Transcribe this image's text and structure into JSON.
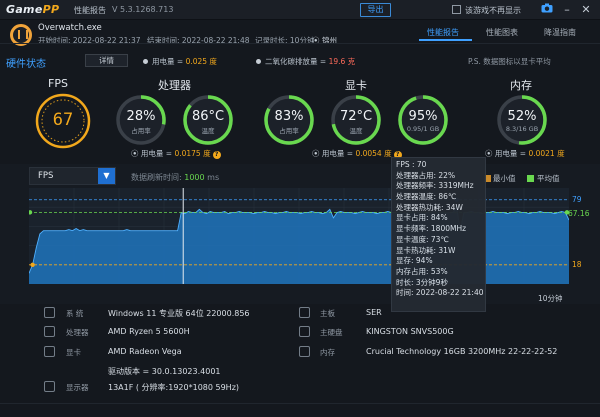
{
  "app": {
    "logo_main": "Game",
    "logo_accent": "PP",
    "menu_label": "性能报告",
    "version": "V 5.3.1268.713",
    "export_label": "导出",
    "no_show_label": "该游戏不再显示"
  },
  "colors": {
    "accent": "#3fa0ff",
    "fps_ring": "#f2a81c",
    "good": "#69d84f",
    "warn": "#f2a81c",
    "danger": "#ff6b5b"
  },
  "icons": [
    "camera-icon",
    "minimize-icon",
    "close-icon",
    "overwatch-logo",
    "location-icon",
    "help-icon"
  ],
  "session": {
    "game": "Overwatch.exe",
    "start": "开始时间: 2022-08-22 21:37",
    "end": "结束时间: 2022-08-22 21:48",
    "duration": "记录时长: 10分钟",
    "location": "锦州"
  },
  "tabs": [
    {
      "label": "性能报告",
      "active": true
    },
    {
      "label": "性能图表",
      "active": false
    },
    {
      "label": "降温指南",
      "active": false
    }
  ],
  "hardware_status": {
    "title": "硬件状态",
    "detail_btn": "详情",
    "power_label": "用电量 = ",
    "power_value": "0.025 度",
    "co2_label": "二氧化碳排放量 = ",
    "co2_value": "19.6 克",
    "ps_note": "P.S. 数据图标以显卡平均"
  },
  "gauges": {
    "fps": {
      "title": "FPS",
      "value": "67"
    },
    "cpu": {
      "title": "处理器",
      "items": [
        {
          "value": "28%",
          "label": "占用率",
          "fill": 0.28,
          "color": "#69d84f"
        },
        {
          "value": "86°C",
          "label": "温度",
          "fill": 0.86,
          "color": "#69d84f"
        }
      ],
      "power_label": "用电量 = ",
      "power_value": "0.0175 度"
    },
    "gpu": {
      "title": "显卡",
      "items": [
        {
          "value": "83%",
          "label": "占用率",
          "fill": 0.83,
          "color": "#69d84f"
        },
        {
          "value": "72°C",
          "label": "温度",
          "fill": 0.72,
          "color": "#69d84f"
        },
        {
          "value": "95%",
          "label": "0.95/1 GB",
          "fill": 0.95,
          "color": "#69d84f"
        }
      ],
      "power_label": "用电量 = ",
      "power_value": "0.0054 度"
    },
    "mem": {
      "title": "内存",
      "items": [
        {
          "value": "52%",
          "label": "8.3/16 GB",
          "fill": 0.52,
          "color": "#69d84f"
        }
      ],
      "power_label": "用电量 = ",
      "power_value": "0.0021 度"
    }
  },
  "chart_controls": {
    "metric": "FPS",
    "refresh_label": "数据刷新时间: ",
    "refresh_value": "1000",
    "refresh_unit": " ms",
    "legend_min": "最小值",
    "legend_avg": "平均值"
  },
  "chart_data": {
    "type": "area",
    "series": [
      {
        "name": "FPS",
        "values": [
          10,
          18,
          34,
          47,
          50,
          50,
          50,
          50,
          50,
          50,
          50,
          51,
          50,
          52,
          50,
          51,
          50,
          50,
          50,
          50,
          50,
          50,
          50,
          50,
          50,
          50,
          50,
          51,
          50,
          50,
          50,
          50,
          50,
          50,
          50,
          50,
          50,
          50,
          50,
          50,
          50,
          50,
          67,
          66,
          68,
          67,
          67,
          70,
          67,
          66,
          68,
          67,
          67,
          67,
          68,
          66,
          67,
          67,
          68,
          67,
          67,
          67,
          66,
          67,
          67,
          68,
          67,
          67,
          66,
          67,
          67,
          68,
          67,
          67,
          67,
          66,
          67,
          67,
          68,
          67,
          67,
          66,
          67,
          70,
          62,
          67,
          68,
          67,
          67,
          67,
          66,
          67,
          68,
          67,
          67,
          67,
          66,
          67,
          67,
          68,
          67,
          67,
          67,
          66,
          67,
          67,
          68,
          67,
          67,
          66,
          67,
          67,
          68,
          67,
          67,
          66,
          67,
          67,
          72,
          50,
          67,
          67,
          68,
          67,
          67,
          66,
          67,
          67,
          68,
          67,
          67,
          67,
          66,
          67,
          67,
          68,
          67,
          67,
          66,
          67,
          67,
          68,
          67,
          67,
          67,
          66,
          67,
          68,
          67,
          60
        ]
      }
    ],
    "max": 79,
    "min": 18,
    "avg": 67.16,
    "y_labels": {
      "max": "79",
      "min": "18",
      "avg": "67.16"
    },
    "x_end_label": "10分钟",
    "ylim": [
      0,
      90
    ],
    "grid": true
  },
  "tooltip": [
    "FPS : 70",
    "处理器占用: 22%",
    "处理器频率: 3319MHz",
    "处理器温度: 86℃",
    "处理器热功耗: 34W",
    "显卡占用: 84%",
    "显卡频率: 1800MHz",
    "显卡温度: 73℃",
    "显卡热功耗: 31W",
    "显存: 94%",
    "内存占用: 53%",
    "时长: 3分钟9秒",
    "时间: 2022-08-22 21:40"
  ],
  "system_info": {
    "left": [
      {
        "label": "系  统",
        "value": "Windows 11 专业版 64位   22000.856"
      },
      {
        "label": "处理器",
        "value": "AMD Ryzen 5 5600H"
      },
      {
        "label": "显卡",
        "value": "AMD Radeon Vega"
      },
      {
        "label": "",
        "value": "驱动版本 = 30.0.13023.4001"
      },
      {
        "label": "显示器",
        "value": "13A1F ( 分辨率:1920*1080 59Hz)"
      }
    ],
    "right": [
      {
        "label": "主板",
        "value": "SER"
      },
      {
        "label": "主硬盘",
        "value": "KINGSTON SNVS500G"
      },
      {
        "label": "内存",
        "value": "Crucial Technology 16GB 3200MHz 22-22-22-52"
      }
    ]
  }
}
